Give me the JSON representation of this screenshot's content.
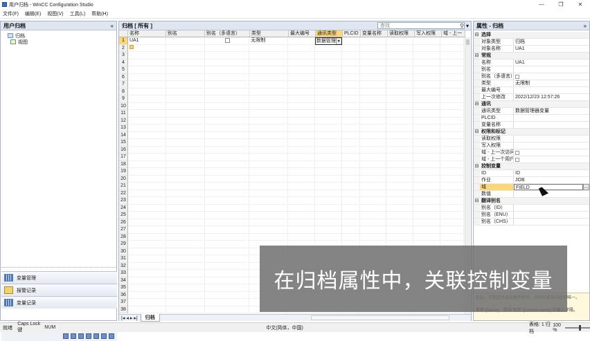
{
  "window": {
    "title": "用户归档 - WinCC Configuration Studio",
    "minimize": "—",
    "maximize": "❐",
    "close": "✕"
  },
  "menu": [
    "文件(F)",
    "编辑(E)",
    "视图(V)",
    "工具(L)",
    "帮助(H)"
  ],
  "left": {
    "header": "用户归档",
    "collapse": "«",
    "tree": [
      "归档",
      "视图"
    ],
    "nav": [
      "变量管理",
      "报警记录",
      "变量记录"
    ]
  },
  "center": {
    "header": "归档 [ 所有 ]",
    "search_placeholder": "查找",
    "columns": [
      "名称",
      "别名",
      "别名（多语言）",
      "类型",
      "最大编号",
      "通讯类型",
      "PLCID",
      "变量名称",
      "读取权限",
      "写入权限",
      "域 - 上一"
    ],
    "rows": [
      {
        "num": "1",
        "name": "UA1",
        "type": "无限制",
        "comm": "数据管理器"
      },
      {
        "num": "2",
        "name": "",
        "type": "",
        "comm": ""
      }
    ],
    "row_numbers": [
      "3",
      "4",
      "5",
      "6",
      "7",
      "8",
      "9",
      "10",
      "11",
      "12",
      "13",
      "14",
      "15",
      "16",
      "17",
      "18",
      "19",
      "20",
      "21",
      "22",
      "23",
      "24",
      "25",
      "26",
      "27",
      "28",
      "29",
      "30",
      "31",
      "32",
      "33",
      "34",
      "35",
      "36",
      "37",
      "38"
    ],
    "sheet_tab": "归档"
  },
  "right": {
    "header": "属性 - 归档",
    "groups": [
      {
        "cat": "选择",
        "rows": [
          [
            "对象类型",
            "归档"
          ],
          [
            "对象名称",
            "UA1"
          ]
        ]
      },
      {
        "cat": "常规",
        "rows": [
          [
            "名称",
            "UA1"
          ],
          [
            "别名",
            ""
          ],
          [
            "别名（多语言）",
            ""
          ],
          [
            "类型",
            "无限制"
          ],
          [
            "最大编号",
            ""
          ],
          [
            "上一次修改",
            "2022/12/23 12:57:26"
          ]
        ]
      },
      {
        "cat": "通讯",
        "rows": [
          [
            "通讯类型",
            "数据管理器变量"
          ],
          [
            "PLCID",
            ""
          ],
          [
            "变量名称",
            ""
          ]
        ]
      },
      {
        "cat": "权限和标记",
        "rows": [
          [
            "读取权限",
            ""
          ],
          [
            "写入权限",
            ""
          ],
          [
            "域 - 上一次访问",
            ""
          ],
          [
            "域 - 上一个用户",
            ""
          ]
        ]
      },
      {
        "cat": "控制变量",
        "rows": [
          [
            "ID",
            "ID"
          ],
          [
            "作业",
            "JOB"
          ],
          [
            "域",
            "FIELD"
          ],
          [
            "数值",
            ""
          ]
        ]
      },
      {
        "cat": "翻译别名",
        "rows": [
          [
            "别名（ID）",
            ""
          ],
          [
            "别名（ENU）",
            ""
          ],
          [
            "别名（CHS）",
            ""
          ]
        ]
      }
    ],
    "desc_title": "名称 (Name)：单击\"列名\"(Column name) 的输入字段。",
    "desc_body": "此处，可指定所选对象的名称，名称在项目中必须唯一。"
  },
  "status": {
    "ready": "就绪",
    "caps": "Caps Lock 键",
    "num": "NUM",
    "ime": "中文(简体，中国)",
    "count": "表格: 1 归档",
    "zoom": "100 %"
  },
  "overlay_caption": "在归档属性中，关联控制变量"
}
